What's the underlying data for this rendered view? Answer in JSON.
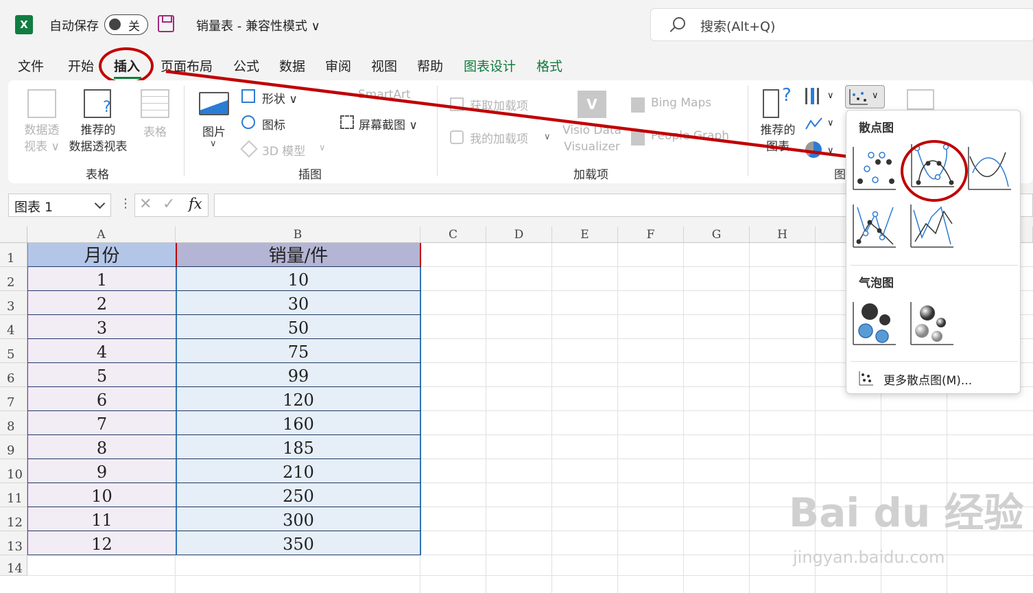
{
  "titlebar": {
    "app_icon_letter": "X",
    "autosave_label": "自动保存",
    "autosave_state": "关",
    "doc_title": "销量表  -  兼容性模式 ∨",
    "search_placeholder": "搜索(Alt+Q)"
  },
  "menu": {
    "items": [
      "文件",
      "开始",
      "插入",
      "页面布局",
      "公式",
      "数据",
      "审阅",
      "视图",
      "帮助",
      "图表设计",
      "格式"
    ]
  },
  "ribbon": {
    "pivot_table": "数据透\n视表 ∨",
    "recommended_pivot": "推荐的\n数据透视表",
    "table": "表格",
    "group_table": "表格",
    "pictures": "图片",
    "shapes": "形状 ∨",
    "icons": "图标",
    "models_3d": "3D 模型",
    "smartart": "SmartArt",
    "screenshot": "屏幕截图 ∨",
    "group_illustrations": "插图",
    "get_addins": "获取加载项",
    "my_addins": "我的加载项",
    "visio": "Visio Data\nVisualizer",
    "bing_maps": "Bing Maps",
    "people_graph": "People Graph",
    "group_addins": "加载项",
    "recommended_charts": "推荐的\n图表",
    "group_charts": "图"
  },
  "formula_bar": {
    "name_box": "图表 1",
    "fx": "fx",
    "formula": ""
  },
  "sheet": {
    "columns": [
      "A",
      "B",
      "C",
      "D",
      "E",
      "F",
      "G",
      "H"
    ],
    "rows": [
      "1",
      "2",
      "3",
      "4",
      "5",
      "6",
      "7",
      "8",
      "9",
      "10",
      "11",
      "12",
      "13",
      "14"
    ],
    "header": [
      "月份",
      "销量/件"
    ],
    "data": [
      [
        "1",
        "10"
      ],
      [
        "2",
        "30"
      ],
      [
        "3",
        "50"
      ],
      [
        "4",
        "75"
      ],
      [
        "5",
        "99"
      ],
      [
        "6",
        "120"
      ],
      [
        "7",
        "160"
      ],
      [
        "8",
        "185"
      ],
      [
        "9",
        "210"
      ],
      [
        "10",
        "250"
      ],
      [
        "11",
        "300"
      ],
      [
        "12",
        "350"
      ]
    ]
  },
  "dropdown": {
    "scatter_title": "散点图",
    "bubble_title": "气泡图",
    "more": "更多散点图(M)..."
  },
  "watermark": {
    "brand": "Bai du 经验",
    "url": "jingyan.baidu.com"
  },
  "colors": {
    "excel_green": "#107c41",
    "annotation_red": "#c00000",
    "header_a": "#b4c6e7",
    "header_b": "#b4b4d4",
    "col_a": "#f2ecf5",
    "col_b": "#e6eef7"
  }
}
